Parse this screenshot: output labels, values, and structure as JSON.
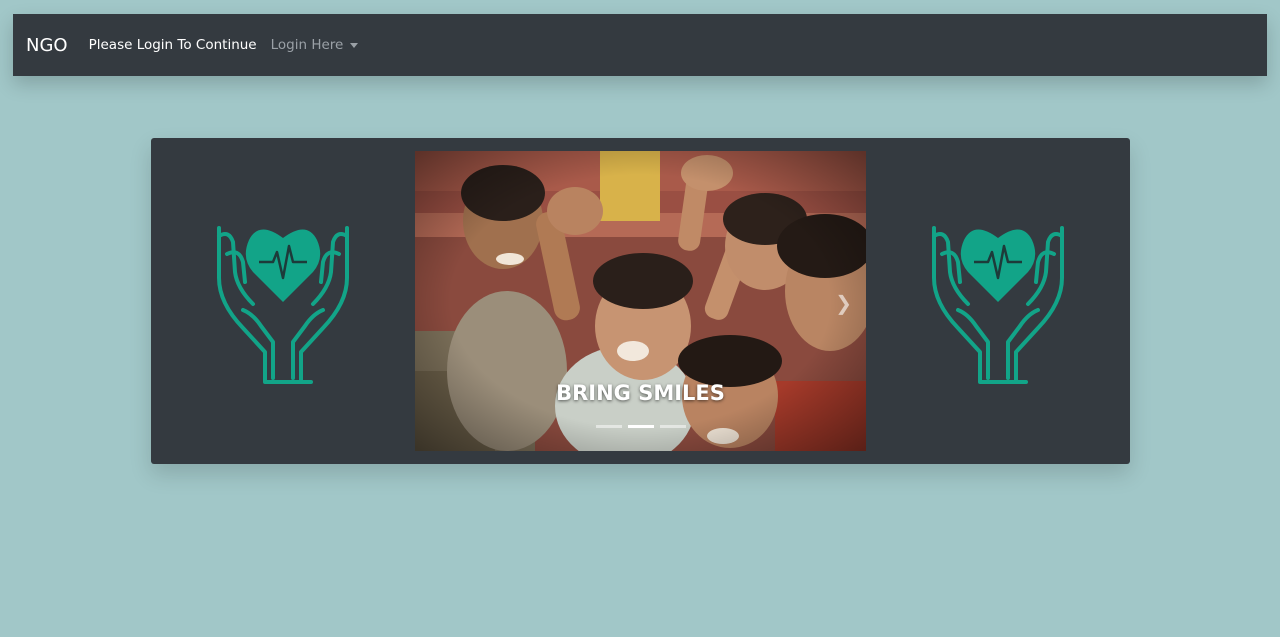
{
  "navbar": {
    "brand": "NGO",
    "message": "Please Login To Continue",
    "dropdown_label": "Login Here"
  },
  "carousel": {
    "caption": "BRING SMILES",
    "indicator_count": 3,
    "active_indicator": 1,
    "next_icon": "chevron-right-icon"
  },
  "logo": {
    "icon": "hands-heart-pulse-icon",
    "color": "#12a488"
  },
  "colors": {
    "page_bg": "#a1c7c8",
    "navbar_bg": "#343a40",
    "panel_bg": "#343a40",
    "accent": "#12a488"
  }
}
